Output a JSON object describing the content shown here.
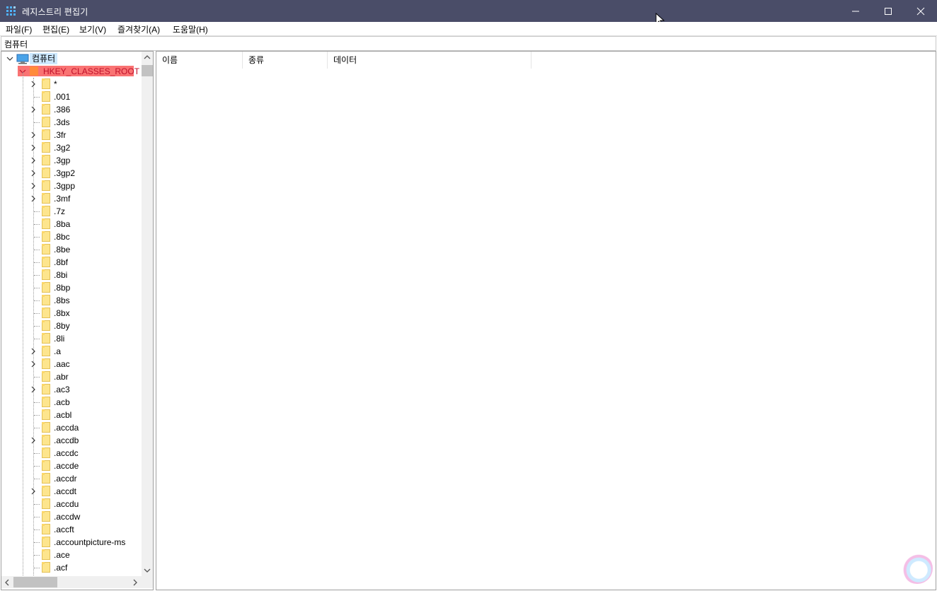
{
  "window": {
    "title": "레지스트리 편집기",
    "controls": [
      "minimize",
      "maximize",
      "close"
    ]
  },
  "menu": [
    {
      "label": "파일(F)"
    },
    {
      "label": "편집(E)"
    },
    {
      "label": "보기(V)"
    },
    {
      "label": "즐겨찾기(A)"
    },
    {
      "label": "도움말(H)"
    }
  ],
  "address": {
    "path": "컴퓨터"
  },
  "tree": {
    "root_label": "컴퓨터",
    "hive": {
      "label": "HKEY_CLASSES_ROOT",
      "expanded": true,
      "highlight_color": "#f97373"
    },
    "items": [
      {
        "label": "*",
        "expandable": true
      },
      {
        "label": ".001",
        "expandable": false
      },
      {
        "label": ".386",
        "expandable": true
      },
      {
        "label": ".3ds",
        "expandable": false
      },
      {
        "label": ".3fr",
        "expandable": true
      },
      {
        "label": ".3g2",
        "expandable": true
      },
      {
        "label": ".3gp",
        "expandable": true
      },
      {
        "label": ".3gp2",
        "expandable": true
      },
      {
        "label": ".3gpp",
        "expandable": true
      },
      {
        "label": ".3mf",
        "expandable": true
      },
      {
        "label": ".7z",
        "expandable": false
      },
      {
        "label": ".8ba",
        "expandable": false
      },
      {
        "label": ".8bc",
        "expandable": false
      },
      {
        "label": ".8be",
        "expandable": false
      },
      {
        "label": ".8bf",
        "expandable": false
      },
      {
        "label": ".8bi",
        "expandable": false
      },
      {
        "label": ".8bp",
        "expandable": false
      },
      {
        "label": ".8bs",
        "expandable": false
      },
      {
        "label": ".8bx",
        "expandable": false
      },
      {
        "label": ".8by",
        "expandable": false
      },
      {
        "label": ".8li",
        "expandable": false
      },
      {
        "label": ".a",
        "expandable": true
      },
      {
        "label": ".aac",
        "expandable": true
      },
      {
        "label": ".abr",
        "expandable": false
      },
      {
        "label": ".ac3",
        "expandable": true
      },
      {
        "label": ".acb",
        "expandable": false
      },
      {
        "label": ".acbl",
        "expandable": false
      },
      {
        "label": ".accda",
        "expandable": false
      },
      {
        "label": ".accdb",
        "expandable": true
      },
      {
        "label": ".accdc",
        "expandable": false
      },
      {
        "label": ".accde",
        "expandable": false
      },
      {
        "label": ".accdr",
        "expandable": false
      },
      {
        "label": ".accdt",
        "expandable": true
      },
      {
        "label": ".accdu",
        "expandable": false
      },
      {
        "label": ".accdw",
        "expandable": false
      },
      {
        "label": ".accft",
        "expandable": false
      },
      {
        "label": ".accountpicture-ms",
        "expandable": false
      },
      {
        "label": ".ace",
        "expandable": false
      },
      {
        "label": ".acf",
        "expandable": false
      }
    ]
  },
  "list": {
    "columns": [
      "이름",
      "종류",
      "데이터"
    ]
  },
  "colors": {
    "titlebar": "#4a4d68",
    "selection_blue": "#cce8ff",
    "folder_yellow": "#fde58d"
  }
}
